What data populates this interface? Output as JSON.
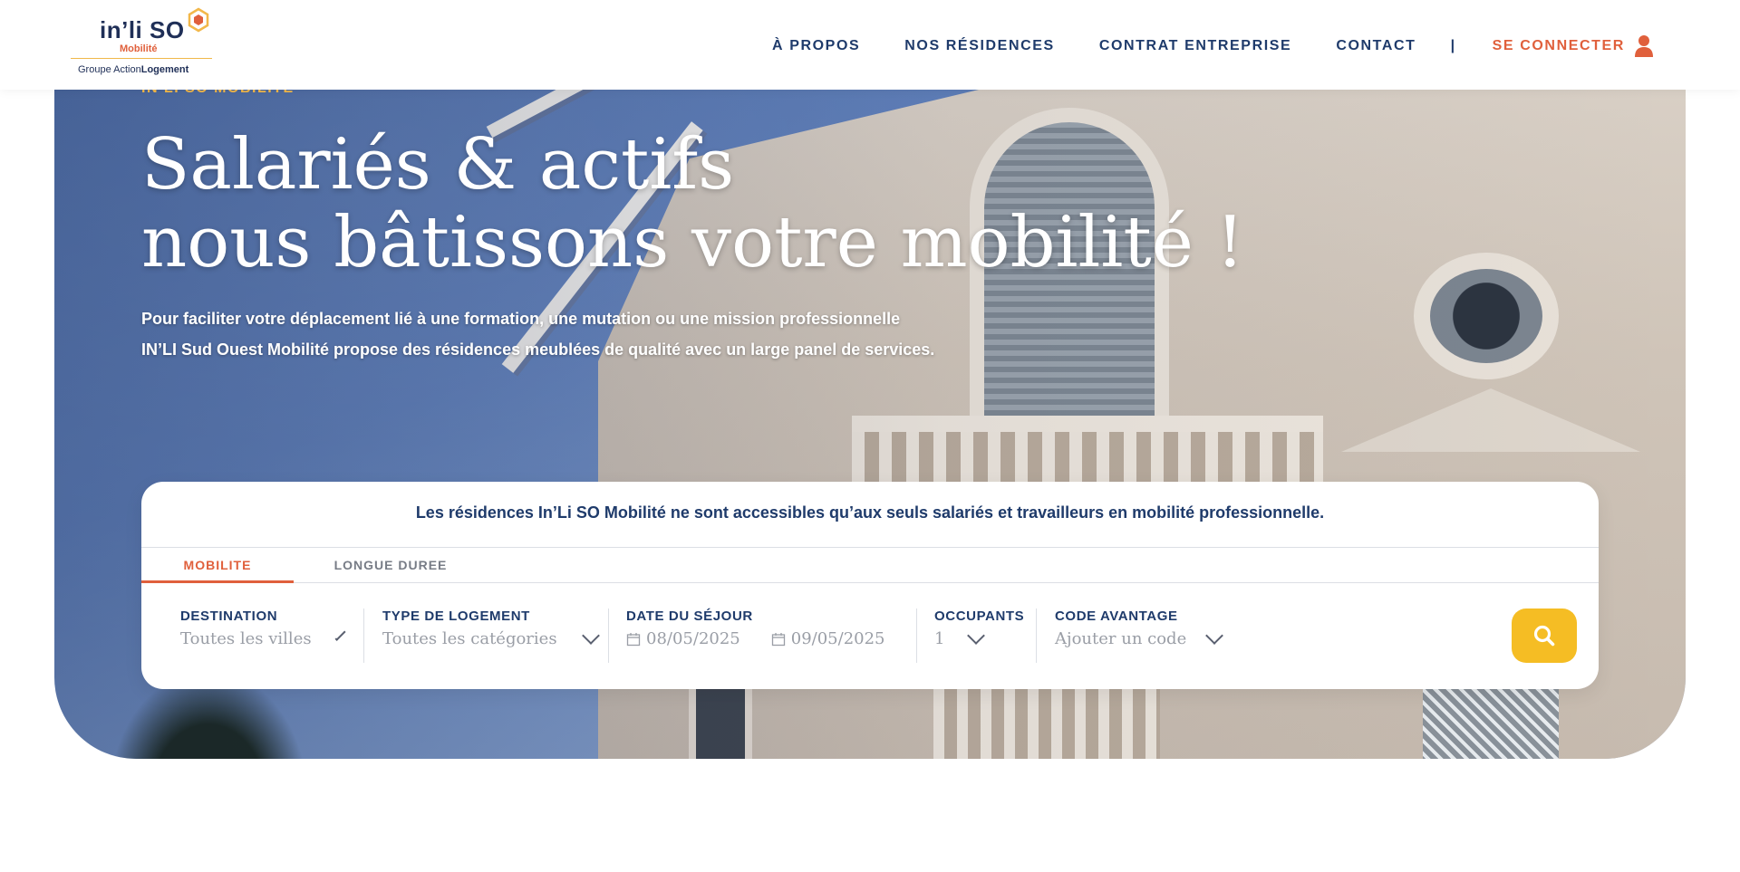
{
  "brand": {
    "name": "in’li SO",
    "subtitle": "Mobilité",
    "group_prefix": "Groupe Action",
    "group_suffix": "Logement"
  },
  "nav": {
    "items": [
      "À PROPOS",
      "NOS RÉSIDENCES",
      "CONTRAT ENTREPRISE",
      "CONTACT"
    ],
    "separator": "|",
    "connect": "SE CONNECTER"
  },
  "hero": {
    "kicker": "IN’LI SO MOBILITÉ",
    "title_line1": "Salariés & actifs",
    "title_line2": "nous bâtissons votre mobilité !",
    "text_line1": "Pour faciliter votre déplacement lié à une formation, une mutation ou une mission professionnelle",
    "text_line2": "IN’LI Sud Ouest Mobilité propose des résidences meublées de qualité avec un large panel de services."
  },
  "search": {
    "notice": "Les résidences In’Li SO Mobilité ne sont accessibles qu’aux seuls salariés et travailleurs en mobilité professionnelle.",
    "tabs": [
      {
        "label": "MOBILITE",
        "active": true
      },
      {
        "label": "LONGUE DUREE",
        "active": false
      }
    ],
    "destination": {
      "label": "DESTINATION",
      "value": "Toutes les villes"
    },
    "type": {
      "label": "TYPE DE LOGEMENT",
      "value": "Toutes les catégories"
    },
    "dates": {
      "label": "DATE DU SÉJOUR",
      "start": "08/05/2025",
      "end": "09/05/2025"
    },
    "occupants": {
      "label": "OCCUPANTS",
      "value": "1"
    },
    "code": {
      "label": "CODE AVANTAGE",
      "placeholder": "Ajouter un code"
    }
  },
  "colors": {
    "primary": "#1f3b6b",
    "accent": "#e0603c",
    "button": "#f5bd24",
    "kicker": "#f2b84a"
  },
  "icons": {
    "user": "user-icon",
    "search": "search-icon",
    "calendar": "calendar-icon",
    "chevron": "chevron-down-icon"
  }
}
